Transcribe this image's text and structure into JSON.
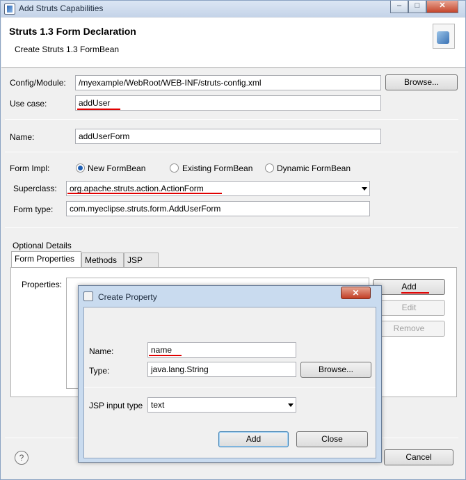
{
  "window": {
    "title": "Add Struts Capabilities",
    "controls": {
      "minimize": "–",
      "maximize": "□",
      "close": "✕"
    }
  },
  "header": {
    "title": "Struts 1.3 Form Declaration",
    "subtitle": "Create Struts 1.3 FormBean",
    "banner_icon": "struts-wizard-icon"
  },
  "form": {
    "config_label": "Config/Module:",
    "config_value": "/myexample/WebRoot/WEB-INF/struts-config.xml",
    "browse_label": "Browse...",
    "usecase_label": "Use case:",
    "usecase_value": "addUser",
    "name_label": "Name:",
    "name_value": "addUserForm",
    "impl_label": "Form Impl:",
    "impl_options": [
      "New FormBean",
      "Existing FormBean",
      "Dynamic FormBean"
    ],
    "impl_selected": "New FormBean",
    "superclass_label": "Superclass:",
    "superclass_value": "org.apache.struts.action.ActionForm",
    "formtype_label": "Form type:",
    "formtype_value": "com.myeclipse.struts.form.AddUserForm"
  },
  "optional": {
    "section_label": "Optional Details",
    "tabs": [
      "Form Properties",
      "Methods",
      "JSP"
    ],
    "active_tab": "Form Properties",
    "properties_label": "Properties:",
    "buttons": {
      "add": "Add",
      "edit": "Edit",
      "remove": "Remove"
    }
  },
  "footer": {
    "help_label": "?",
    "cancel_label": "Cancel"
  },
  "dialog": {
    "title": "Create Property",
    "close_label": "✕",
    "name_label": "Name:",
    "name_value": "name",
    "type_label": "Type:",
    "type_value": "java.lang.String",
    "browse_label": "Browse...",
    "jsp_label": "JSP input type",
    "jsp_value": "text",
    "add_label": "Add",
    "close_button_label": "Close"
  },
  "colors": {
    "annotation_underline": "#e00000",
    "radio_selected": "#1f5fb4",
    "dialog_frame": "#c9dbef"
  }
}
